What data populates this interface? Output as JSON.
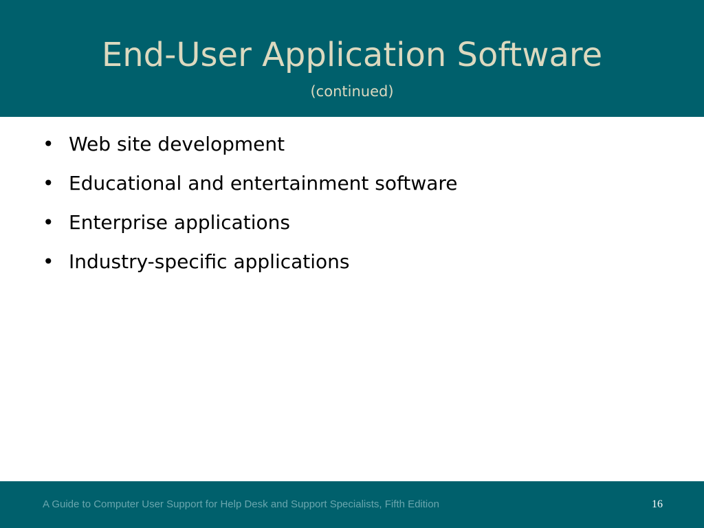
{
  "slide": {
    "title": "End-User Application Software",
    "subtitle": "(continued)",
    "bullet_symbol": "•",
    "bullets": [
      "Web site development",
      "Educational and entertainment software",
      "Enterprise applications",
      "Industry-specific applications"
    ],
    "footer_text": "A Guide to Computer User Support for Help Desk and Support Specialists, Fifth Edition",
    "page_number": "16"
  },
  "colors": {
    "header_background": "#00606c",
    "title_text": "#dcd9bf",
    "footer_background": "#00606c",
    "footer_text": "#6aa6ae",
    "page_number_text": "#ffffff",
    "body_background": "#ffffff",
    "bullet_text": "#000000"
  }
}
